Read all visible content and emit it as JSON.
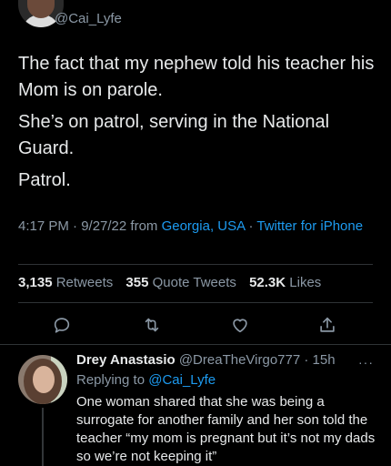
{
  "tweet": {
    "handle": "@Cai_Lyfe",
    "paragraphs": [
      "The fact that my nephew told his teacher his Mom is on parole.",
      "She’s on patrol, serving in the National Guard.",
      "Patrol."
    ],
    "time_date": "4:17 PM · 9/27/22 from ",
    "location": "Georgia, USA",
    "separator": " · ",
    "source": "Twitter for iPhone"
  },
  "stats": {
    "retweets_count": "3,135",
    "retweets_label": "Retweets",
    "quotes_count": "355",
    "quotes_label": "Quote Tweets",
    "likes_count": "52.3K",
    "likes_label": "Likes"
  },
  "actions": {
    "icons": [
      "reply-icon",
      "retweet-icon",
      "like-icon",
      "share-icon"
    ],
    "color": "#8b98a5"
  },
  "reply": {
    "name": "Drey Anastasio",
    "handle_time": "@DreaTheVirgo777 · 15h",
    "replying_prefix": "Replying to ",
    "replying_to": "@Cai_Lyfe",
    "text": "One woman shared that she was being a surrogate for another family and her son told the teacher “my mom is pregnant but it’s not my dads so we’re not keeping it”",
    "more": "···"
  },
  "colors": {
    "background": "#000000",
    "text": "#e7e9ea",
    "secondary": "#8b98a5",
    "link": "#1d9bf0",
    "divider": "#2f3336"
  }
}
